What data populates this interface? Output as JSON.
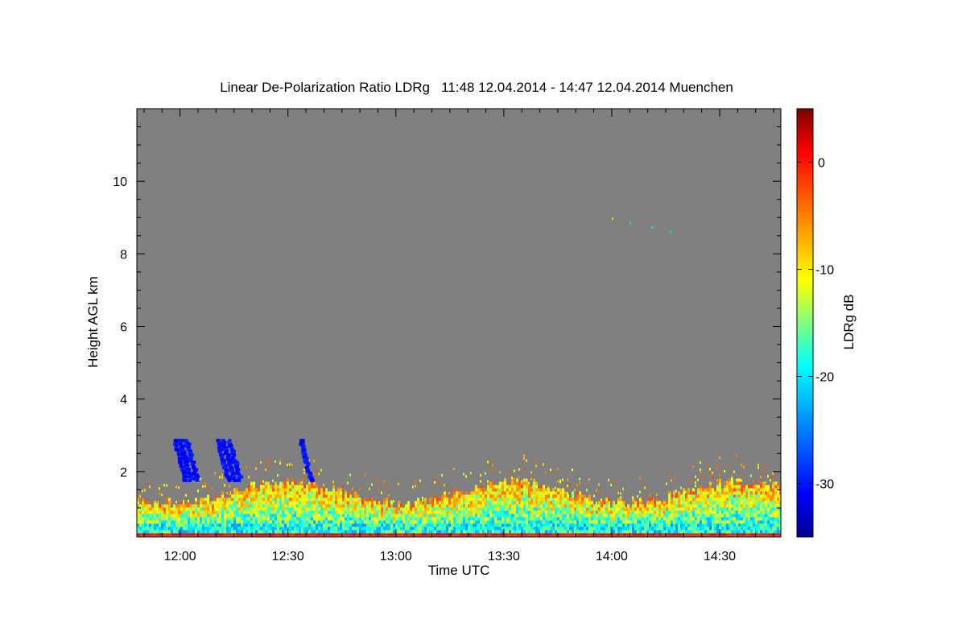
{
  "chart_data": {
    "type": "heatmap",
    "title": "Linear De-Polarization Ratio LDRg   11:48 12.04.2014 - 14:47 12.04.2014 Muenchen",
    "xlabel": "Time UTC",
    "ylabel": "Height AGL km",
    "colorbar_label": "LDRg dB",
    "x_range": [
      "11:48",
      "14:47"
    ],
    "x_ticks": [
      "12:00",
      "12:30",
      "13:00",
      "13:30",
      "14:00",
      "14:30"
    ],
    "ylim": [
      0.2,
      12.0
    ],
    "y_ticks": [
      "2",
      "4",
      "6",
      "8",
      "10"
    ],
    "colorbar_range": [
      -35,
      5
    ],
    "colorbar_ticks": [
      "0",
      "-10",
      "-20",
      "-30"
    ],
    "missing_color": "#808080",
    "colormap": [
      "#00008f",
      "#0000ff",
      "#00ffff",
      "#ffff00",
      "#ff8000",
      "#ff0000",
      "#800000"
    ],
    "features": [
      {
        "label": "boundary layer aerosol",
        "height_km": [
          0.3,
          1.6
        ],
        "ldr_db": [
          -22,
          -5
        ]
      },
      {
        "label": "low depolarization fall streaks",
        "times": [
          "11:58",
          "12:10",
          "12:33"
        ],
        "height_km": [
          1.8,
          2.9
        ],
        "ldr_db": -32
      },
      {
        "label": "scattered high-level returns",
        "times": [
          "14:00",
          "14:05",
          "14:11",
          "14:16"
        ],
        "height_km": [
          8.6,
          9.0
        ],
        "ldr_db": -12
      }
    ]
  }
}
